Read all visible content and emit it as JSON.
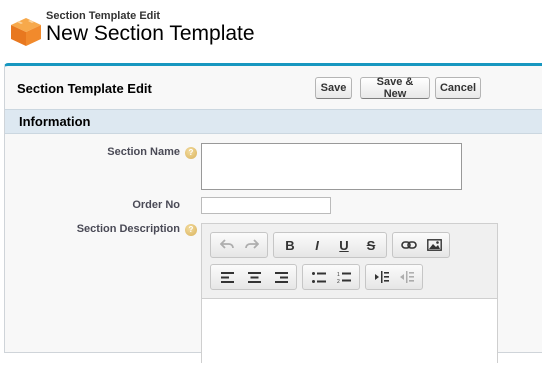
{
  "header": {
    "subtitle": "Section Template Edit",
    "title": "New Section Template",
    "icon": "cube-icon"
  },
  "panel": {
    "title": "Section Template Edit",
    "buttons": {
      "save": "Save",
      "save_new": "Save & New",
      "cancel": "Cancel"
    }
  },
  "section": {
    "title": "Information"
  },
  "fields": {
    "section_name": {
      "label": "Section Name",
      "value": ""
    },
    "order_no": {
      "label": "Order No",
      "value": ""
    },
    "section_description": {
      "label": "Section Description"
    }
  },
  "toolbar": {
    "bold": "B",
    "italic": "I",
    "underline": "U",
    "strikethrough": "S"
  },
  "colors": {
    "accent": "#1797c0",
    "section_bar": "#dde8f1",
    "icon_orange": "#f0892a"
  }
}
